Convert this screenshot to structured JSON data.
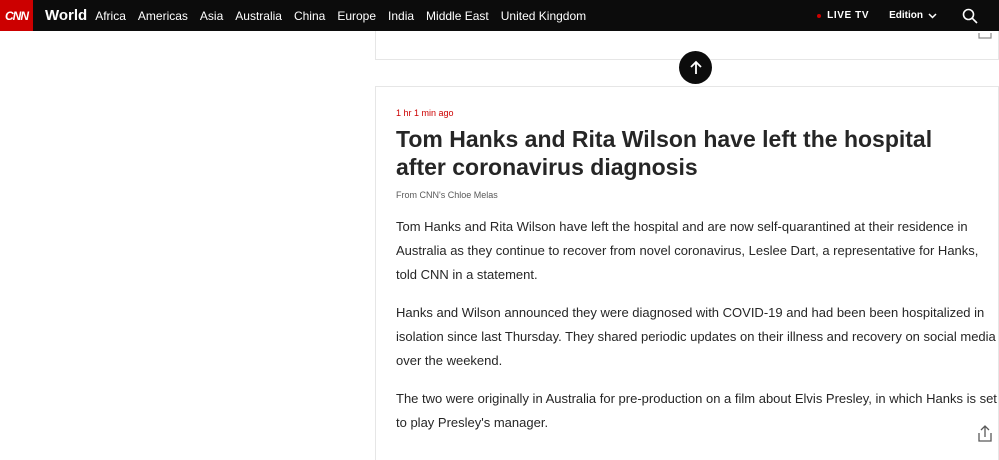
{
  "header": {
    "logo": "CNN",
    "section": "World",
    "nav": [
      "Africa",
      "Americas",
      "Asia",
      "Australia",
      "China",
      "Europe",
      "India",
      "Middle East",
      "United Kingdom"
    ],
    "live_tv": "LIVE TV",
    "edition": "Edition"
  },
  "post": {
    "timestamp": "1 hr 1 min ago",
    "headline": "Tom Hanks and Rita Wilson have left the hospital after coronavirus diagnosis",
    "byline": "From CNN's Chloe Melas",
    "paragraphs": [
      "Tom Hanks and Rita Wilson have left the hospital and are now self-quarantined at their residence in Australia as they continue to recover from novel coronavirus, Leslee Dart, a representative for Hanks, told CNN in a statement.",
      "Hanks and Wilson announced they were diagnosed with COVID-19 and had been been hospitalized in isolation since last Thursday. They shared periodic updates on their illness and recovery on social media over the weekend.",
      "The two were originally in Australia for pre-production on a film about Elvis Presley, in which Hanks is set to play Presley's manager."
    ]
  },
  "icons": {
    "search": "search-icon",
    "chevron": "chevron-down-icon",
    "share": "share-icon",
    "arrow_up": "arrow-up-icon"
  },
  "colors": {
    "brand_red": "#cc0000",
    "nav_bg": "#0c0c0c"
  }
}
